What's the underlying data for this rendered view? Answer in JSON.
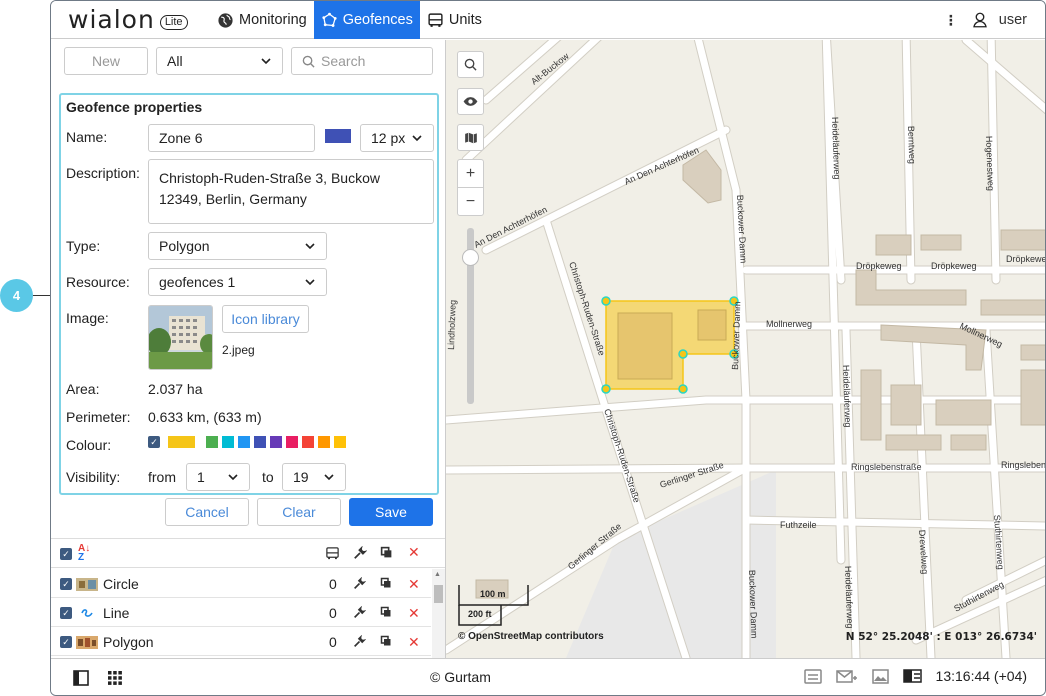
{
  "callout": "4",
  "header": {
    "logo": "wialon",
    "logo_badge": "Lite",
    "nav": [
      {
        "label": "Monitoring",
        "icon": "globe-icon"
      },
      {
        "label": "Geofences",
        "icon": "geofence-icon",
        "active": true
      },
      {
        "label": "Units",
        "icon": "bus-icon"
      }
    ],
    "user": "user"
  },
  "toolbar": {
    "new_label": "New",
    "filter_value": "All",
    "search_placeholder": "Search"
  },
  "props": {
    "title": "Geofence properties",
    "name_label": "Name:",
    "name_value": "Zone 6",
    "line_color": "#3f51b5",
    "line_width": "12 px",
    "description_label": "Description:",
    "description_value": "Christoph-Ruden-Straße 3, Buckow 12349, Berlin, Germany",
    "type_label": "Type:",
    "type_value": "Polygon",
    "resource_label": "Resource:",
    "resource_value": "geofences 1",
    "image_label": "Image:",
    "icon_library_label": "Icon library",
    "image_file": "2.jpeg",
    "area_label": "Area:",
    "area_value": "2.037 ha",
    "perimeter_label": "Perimeter:",
    "perimeter_value": "0.633 km, (633 m)",
    "colour_label": "Colour:",
    "colours": [
      "#f5c518",
      "#4caf50",
      "#00bcd4",
      "#2196f3",
      "#3f51b5",
      "#673ab7",
      "#e91e63",
      "#f44336",
      "#ff9800",
      "#ffc107"
    ],
    "visibility_label": "Visibility:",
    "from_label": "from",
    "from_value": "1",
    "to_label": "to",
    "to_value": "19"
  },
  "actions": {
    "cancel": "Cancel",
    "clear": "Clear",
    "save": "Save"
  },
  "list": [
    {
      "name": "Circle",
      "count": "0",
      "icon": "circle-geofence-icon"
    },
    {
      "name": "Line",
      "count": "0",
      "icon": "line-geofence-icon"
    },
    {
      "name": "Polygon",
      "count": "0",
      "icon": "polygon-geofence-icon"
    }
  ],
  "map": {
    "streets": [
      "Alt-Buckow",
      "An Den Achterhöfen",
      "Buckower Damm",
      "Heideläuferweg",
      "Berntweg",
      "Hogenestweg",
      "Dröpkeweg",
      "Mollnerweg",
      "Christoph-Ruden-Straße",
      "Lindholzweg",
      "Ringslebenstraße",
      "Gerlinger Straße",
      "Futhzeile",
      "Drewelweg",
      "Stuthirtenweg"
    ],
    "scale_m": "100 m",
    "scale_ft": "200 ft",
    "attribution": "© OpenStreetMap contributors",
    "coords": "N 52° 25.2048' : E 013° 26.6734'"
  },
  "footer": {
    "copyright": "© Gurtam",
    "time": "13:16:44 (+04)"
  }
}
